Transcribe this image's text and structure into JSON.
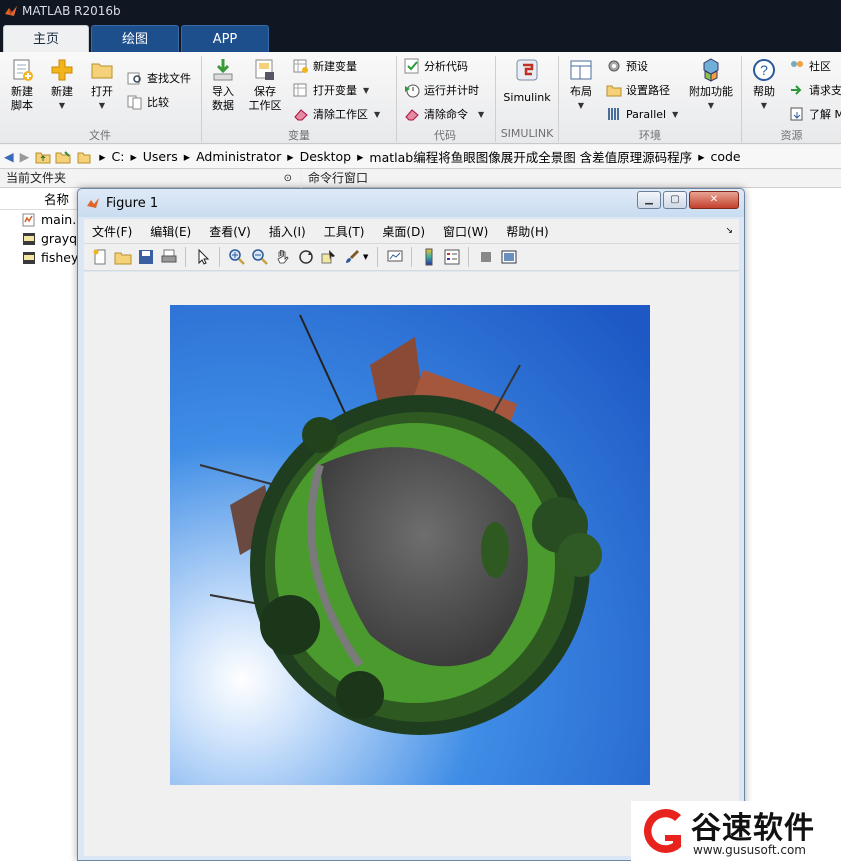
{
  "app": {
    "title": "MATLAB R2016b"
  },
  "tabs": [
    {
      "label": "主页"
    },
    {
      "label": "绘图"
    },
    {
      "label": "APP"
    }
  ],
  "ribbon": {
    "file": {
      "new_script": [
        "新建",
        "脚本"
      ],
      "new": "新建",
      "open": "打开",
      "find_files": "查找文件",
      "compare": "比较",
      "group": "文件"
    },
    "variable": {
      "import_data": [
        "导入",
        "数据"
      ],
      "save_workspace": [
        "保存",
        "工作区"
      ],
      "new_variable": "新建变量",
      "open_variable": "打开变量",
      "clear_workspace": "清除工作区",
      "group": "变量"
    },
    "code": {
      "analyze_code": "分析代码",
      "run_and_time": "运行并计时",
      "clear_commands": "清除命令",
      "group": "代码"
    },
    "simulink": {
      "label": "Simulink",
      "group": "SIMULINK"
    },
    "environment": {
      "layout": "布局",
      "preferences": "预设",
      "set_path": "设置路径",
      "parallel": "Parallel",
      "addons": "附加功能",
      "group": "环境"
    },
    "resources": {
      "help": "帮助",
      "community": "社区",
      "request_support": "请求支",
      "learn_matlab": "了解 M",
      "group": "资源"
    }
  },
  "address": {
    "segments": [
      "C:",
      "Users",
      "Administrator",
      "Desktop",
      "matlab编程将鱼眼图像展开成全景图 含差值原理源码程序",
      "code"
    ]
  },
  "current_folder": {
    "title": "当前文件夹",
    "column_name": "名称",
    "files": [
      {
        "name": "main.m",
        "icon": "m-file-icon"
      },
      {
        "name": "grayqj",
        "icon": "jpg-file-icon"
      },
      {
        "name": "fisheye",
        "icon": "jpg-file-icon"
      }
    ]
  },
  "command_window": {
    "title": "命令行窗口"
  },
  "figure": {
    "title": "Figure 1",
    "menu": [
      "文件(F)",
      "编辑(E)",
      "查看(V)",
      "插入(I)",
      "工具(T)",
      "桌面(D)",
      "窗口(W)",
      "帮助(H)"
    ],
    "image_description": "tiny-planet fisheye panorama"
  },
  "watermark": {
    "brand": "谷速软件",
    "url": "www.gususoft.com",
    "accent": "#e8231d"
  },
  "colors": {
    "titlebar": "#101722",
    "tab_blue": "#1c4f8c",
    "sky": "#1f6fd0",
    "grass": "#3f8a2a"
  }
}
